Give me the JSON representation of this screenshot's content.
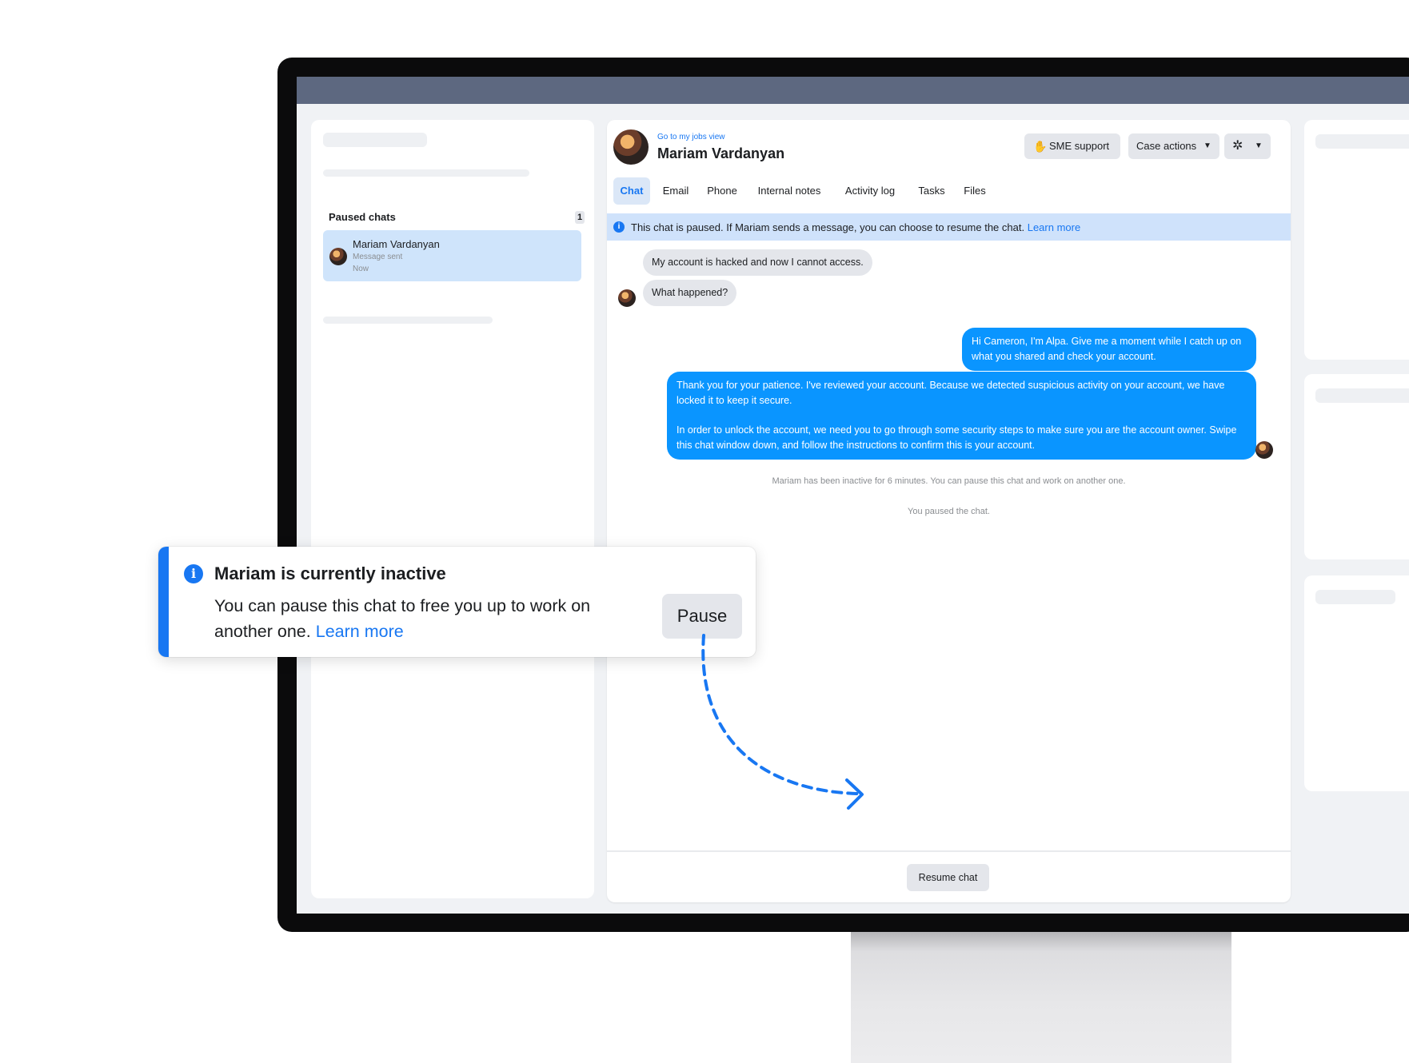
{
  "left": {
    "section_title": "Paused chats",
    "section_count": "1",
    "item": {
      "name": "Mariam Vardanyan",
      "status": "Message sent",
      "time": "Now"
    }
  },
  "chat": {
    "jobs_link": "Go to my jobs view",
    "contact_name": "Mariam Vardanyan",
    "buttons": {
      "sme": "SME support",
      "case_actions": "Case actions"
    },
    "tabs": [
      {
        "label": "Chat"
      },
      {
        "label": "Email"
      },
      {
        "label": "Phone"
      },
      {
        "label": "Internal notes"
      },
      {
        "label": "Activity log"
      },
      {
        "label": "Tasks"
      },
      {
        "label": "Files"
      }
    ],
    "banner": {
      "text": "This chat is paused. If Mariam sends a message, you can choose to resume the chat.",
      "link": "Learn more"
    },
    "messages": {
      "in1": "My account is hacked and now I cannot access.",
      "in2": "What happened?",
      "out1": "Hi Cameron, I'm Alpa. Give me a moment while I catch up on what you shared and check your account.",
      "out2a": "Thank you for your patience. I've reviewed your account. Because we detected suspicious activity on your account, we have locked it to keep it secure.",
      "out2b": "In order to unlock the account, we need you to go through some security steps to make sure you are the account owner. Swipe this chat window down, and follow the instructions to confirm this is your account."
    },
    "system": {
      "inactive": "Mariam has been inactive for 6 minutes. You can pause this chat and work on another one.",
      "paused": "You paused the chat."
    },
    "resume_label": "Resume chat"
  },
  "toast": {
    "title": "Mariam is currently inactive",
    "body": "You can pause this chat to free you up to work on another one.",
    "link": "Learn more",
    "button": "Pause"
  },
  "icons": {
    "info": "info-icon",
    "hand": "hand-icon",
    "caret": "caret-down-icon",
    "tools": "tools-icon"
  },
  "colors": {
    "accent": "#1877f2",
    "outgoing_bubble": "#0a95ff",
    "paused_item_bg": "#cfe4fb",
    "banner_bg": "#cfe2fb",
    "topbar": "#5d6880"
  }
}
